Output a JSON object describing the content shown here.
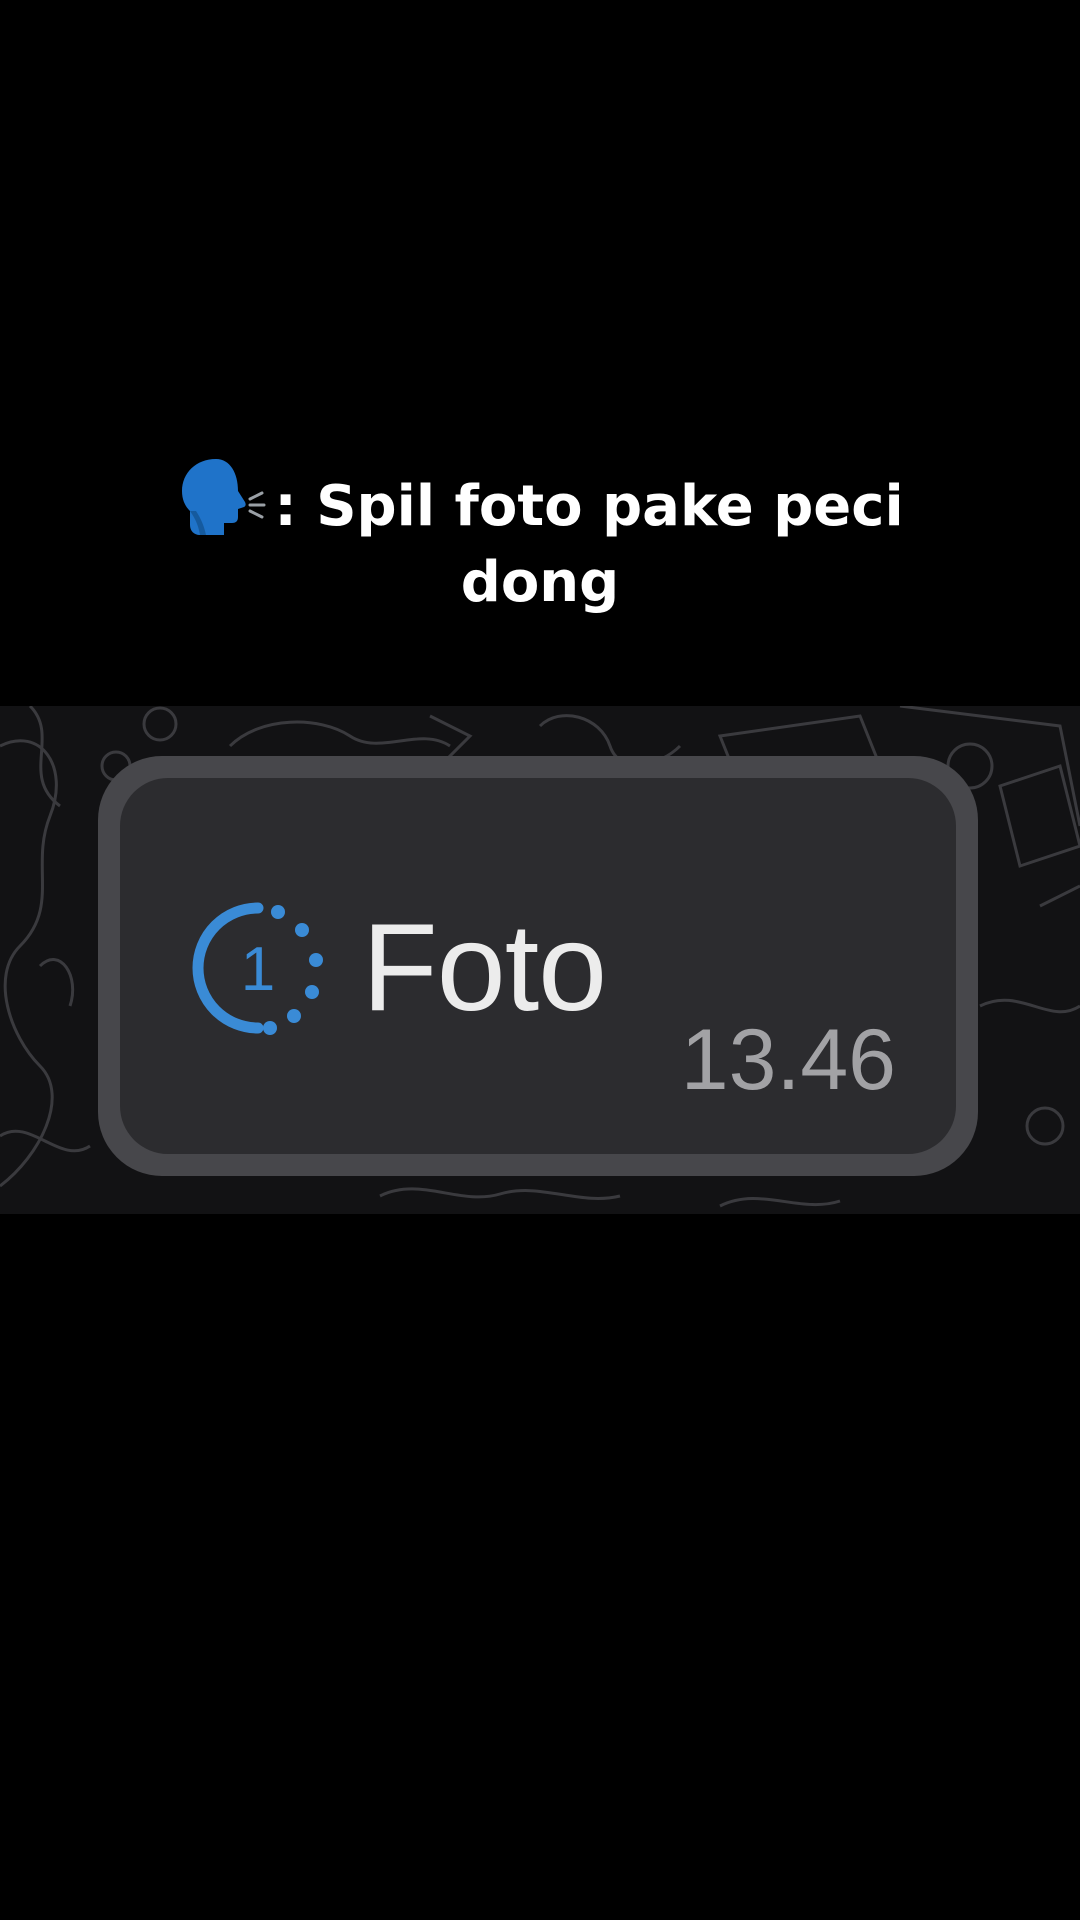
{
  "caption": {
    "icon": "speaking-head-icon",
    "line1": ": Spil foto pake peci",
    "line2": "dong"
  },
  "message": {
    "icon": "view-once-icon",
    "icon_digit": "1",
    "label": "Foto",
    "time": "13.46"
  },
  "colors": {
    "background": "#000000",
    "caption_text": "#ffffff",
    "icon_blue": "#3a8bd6",
    "bubble": "#2c2c2f",
    "bubble_border": "#47474b",
    "message_text": "#ececec",
    "timestamp": "#a2a2a5"
  }
}
